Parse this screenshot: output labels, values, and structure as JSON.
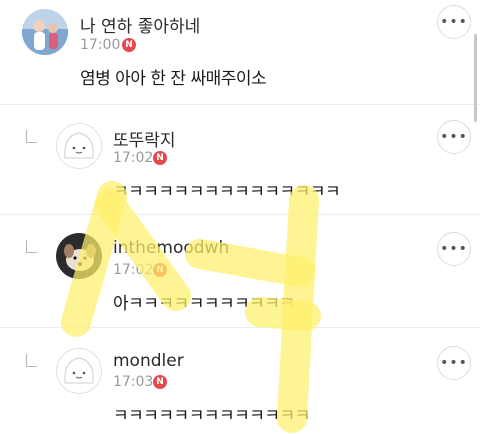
{
  "comments": [
    {
      "name": "나 연하 좋아하네",
      "time": "17:00",
      "badge": "N",
      "text": "염병 아아 한 잔 싸매주이소",
      "more": "•••",
      "avatar": "profile-photo",
      "is_reply": false
    },
    {
      "name": "또뚜락지",
      "time": "17:02",
      "badge": "N",
      "text": "ㅋㅋㅋㅋㅋㅋㅋㅋㅋㅋㅋㅋㅋㅋㅋ",
      "more": "•••",
      "avatar": "default-face",
      "is_reply": true
    },
    {
      "name": "inthemoodwh",
      "time": "17:02",
      "badge": "N",
      "text": "아ㅋㅋㅋㅋㅋㅋㅋㅋㅋㅋㅋ",
      "more": "•••",
      "avatar": "dog-photo",
      "is_reply": true
    },
    {
      "name": "mondler",
      "time": "17:03",
      "badge": "N",
      "text": "ㅋㅋㅋㅋㅋㅋㅋㅋㅋㅋㅋㅋㅋ",
      "more": "•••",
      "avatar": "default-face",
      "is_reply": true
    }
  ],
  "watermark": {
    "text": "스마",
    "color": "#fff27a"
  },
  "colors": {
    "badge": "#e5484d",
    "divider": "#ececec"
  }
}
